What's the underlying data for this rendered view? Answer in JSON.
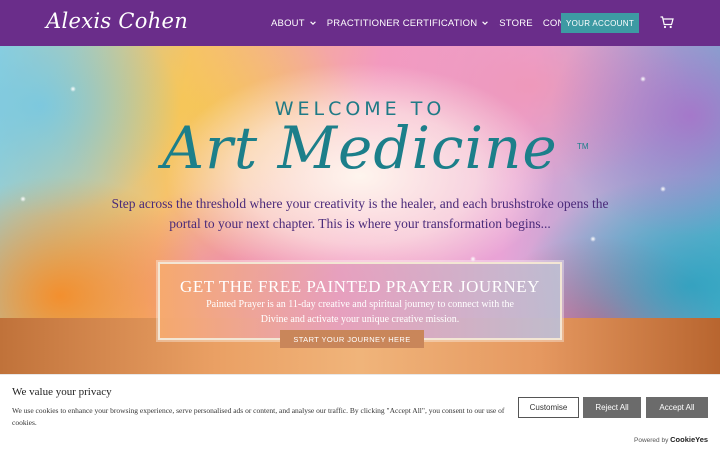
{
  "header": {
    "logo": "Alexis Cohen",
    "nav": [
      {
        "label": "ABOUT",
        "has_dropdown": true
      },
      {
        "label": "PRACTITIONER CERTIFICATION",
        "has_dropdown": true
      },
      {
        "label": "STORE",
        "has_dropdown": false
      },
      {
        "label": "CONTACT",
        "has_dropdown": false
      }
    ],
    "account_button": "YOUR ACCOUNT",
    "cart_icon": "cart-icon",
    "bg_color": "#6a2d8a",
    "accent_color": "#3d9aa3"
  },
  "hero": {
    "welcome": "WELCOME TO",
    "brand": "Art Medicine",
    "tm": "TM",
    "tagline": "Step across the threshold where your creativity is the healer, and each brushstroke opens the portal to your next chapter. This is where your transformation begins...",
    "brand_color": "#1c7f8a",
    "tagline_color": "#4a2a7a"
  },
  "promo": {
    "title": "GET THE FREE PAINTED PRAYER JOURNEY",
    "text": "Painted Prayer is an 11-day creative and spiritual journey to connect with the Divine and activate your unique creative mission.",
    "button": "START YOUR JOURNEY HERE"
  },
  "cookie": {
    "title": "We value your privacy",
    "text": "We use cookies to enhance your browsing experience, serve personalised ads or content, and analyse our traffic. By clicking \"Accept All\", you consent to our use of cookies.",
    "customise": "Customise",
    "reject": "Reject All",
    "accept": "Accept All",
    "powered_by": "Powered by",
    "powered_brand": "CookieYes"
  }
}
